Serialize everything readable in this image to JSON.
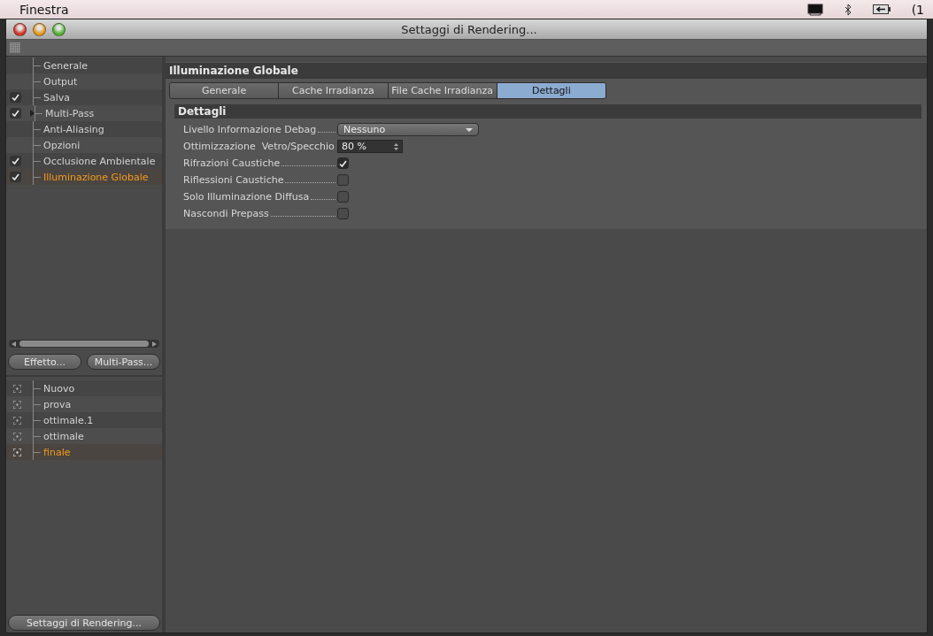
{
  "menu_bar": {
    "title": "Finestra",
    "battery_text": "(1"
  },
  "window": {
    "title": "Settaggi di Rendering..."
  },
  "settings_tree": [
    {
      "label": "Generale",
      "checked": false,
      "selected": false,
      "kind": "item"
    },
    {
      "label": "Output",
      "checked": false,
      "selected": false,
      "kind": "item"
    },
    {
      "label": "Salva",
      "checked": true,
      "selected": false,
      "kind": "item"
    },
    {
      "label": "Multi-Pass",
      "checked": true,
      "selected": false,
      "kind": "group"
    },
    {
      "label": "Anti-Aliasing",
      "checked": false,
      "selected": false,
      "kind": "item"
    },
    {
      "label": "Opzioni",
      "checked": false,
      "selected": false,
      "kind": "item"
    },
    {
      "label": "Occlusione Ambientale",
      "checked": true,
      "selected": false,
      "kind": "item"
    },
    {
      "label": "Illuminazione Globale",
      "checked": true,
      "selected": true,
      "kind": "item"
    }
  ],
  "effect_buttons": [
    "Effetto...",
    "Multi-Pass..."
  ],
  "presets": [
    {
      "label": "Nuovo",
      "selected": false
    },
    {
      "label": "prova",
      "selected": false
    },
    {
      "label": "ottimale.1",
      "selected": false
    },
    {
      "label": "ottimale",
      "selected": false
    },
    {
      "label": "finale",
      "selected": true
    }
  ],
  "render_settings_button": "Settaggi di Rendering...",
  "panel": {
    "title": "Illuminazione Globale",
    "tabs": [
      {
        "label": "Generale",
        "selected": false
      },
      {
        "label": "Cache Irradianza",
        "selected": false
      },
      {
        "label": "File Cache Irradianza",
        "selected": false
      },
      {
        "label": "Dettagli",
        "selected": true
      }
    ],
    "section": {
      "title": "Dettagli",
      "fields": [
        {
          "kind": "dropdown",
          "label": "Livello Informazione Debag",
          "value": "Nessuno"
        },
        {
          "kind": "number",
          "label": "Ottimizzazione  Vetro/Specchio",
          "value": "80 %"
        },
        {
          "kind": "checkbox",
          "label": "Rifrazioni Caustiche",
          "checked": true
        },
        {
          "kind": "checkbox",
          "label": "Riflessioni Caustiche",
          "checked": false
        },
        {
          "kind": "checkbox",
          "label": "Solo Illuminazione Diffusa",
          "checked": false
        },
        {
          "kind": "checkbox",
          "label": "Nascondi Prepass",
          "checked": false
        }
      ]
    }
  }
}
